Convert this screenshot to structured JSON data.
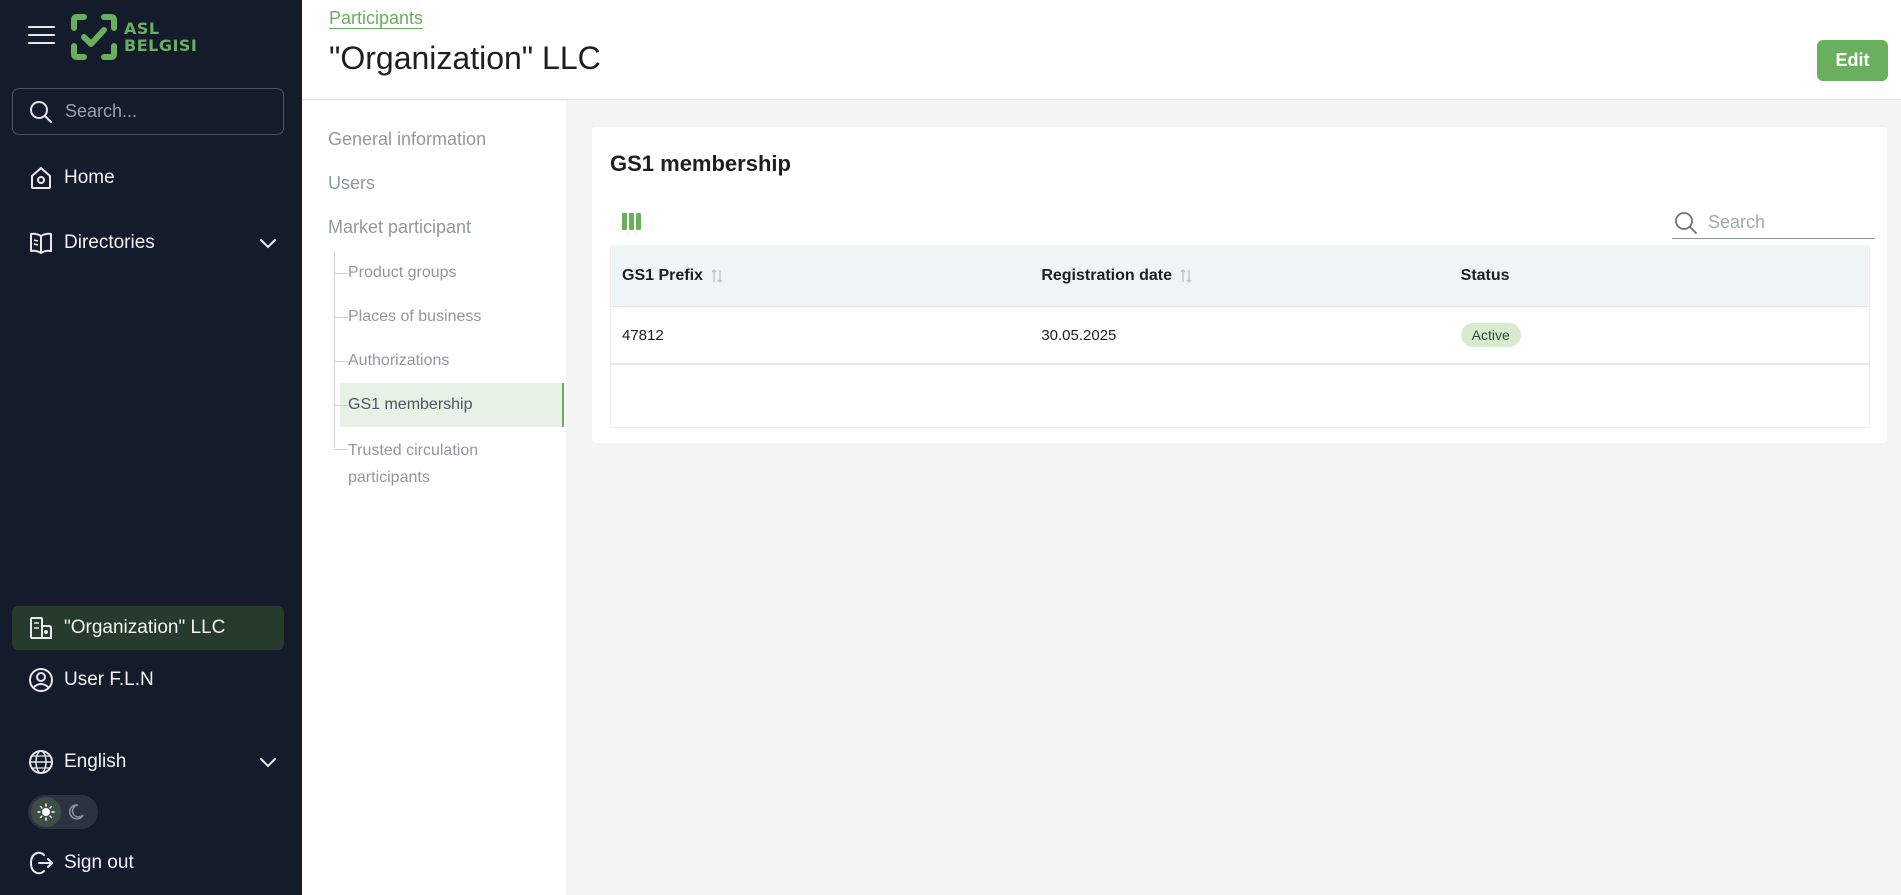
{
  "sidebar": {
    "logo": {
      "line1": "ASL",
      "line2": "BELGISI"
    },
    "search_placeholder": "Search...",
    "nav": {
      "home": "Home",
      "directories": "Directories"
    },
    "organization": "\"Organization\" LLC",
    "user": "User F.L.N",
    "language": "English",
    "sign_out": "Sign out"
  },
  "header": {
    "breadcrumb": "Participants",
    "title": "\"Organization\" LLC",
    "edit_label": "Edit"
  },
  "subnav": {
    "general": "General information",
    "users": "Users",
    "market": "Market participant",
    "children": [
      "Product groups",
      "Places of business",
      "Authorizations",
      "GS1 membership",
      "Trusted circulation participants"
    ]
  },
  "card": {
    "title": "GS1 membership",
    "search_placeholder": "Search",
    "columns": [
      "GS1 Prefix",
      "Registration date",
      "Status"
    ],
    "rows": [
      {
        "prefix": "47812",
        "date": "30.05.2025",
        "status": "Active"
      }
    ]
  },
  "colors": {
    "accent": "#6aaf5e",
    "sidebar_bg": "#141b2b",
    "active_org_bg": "#263b2b"
  }
}
